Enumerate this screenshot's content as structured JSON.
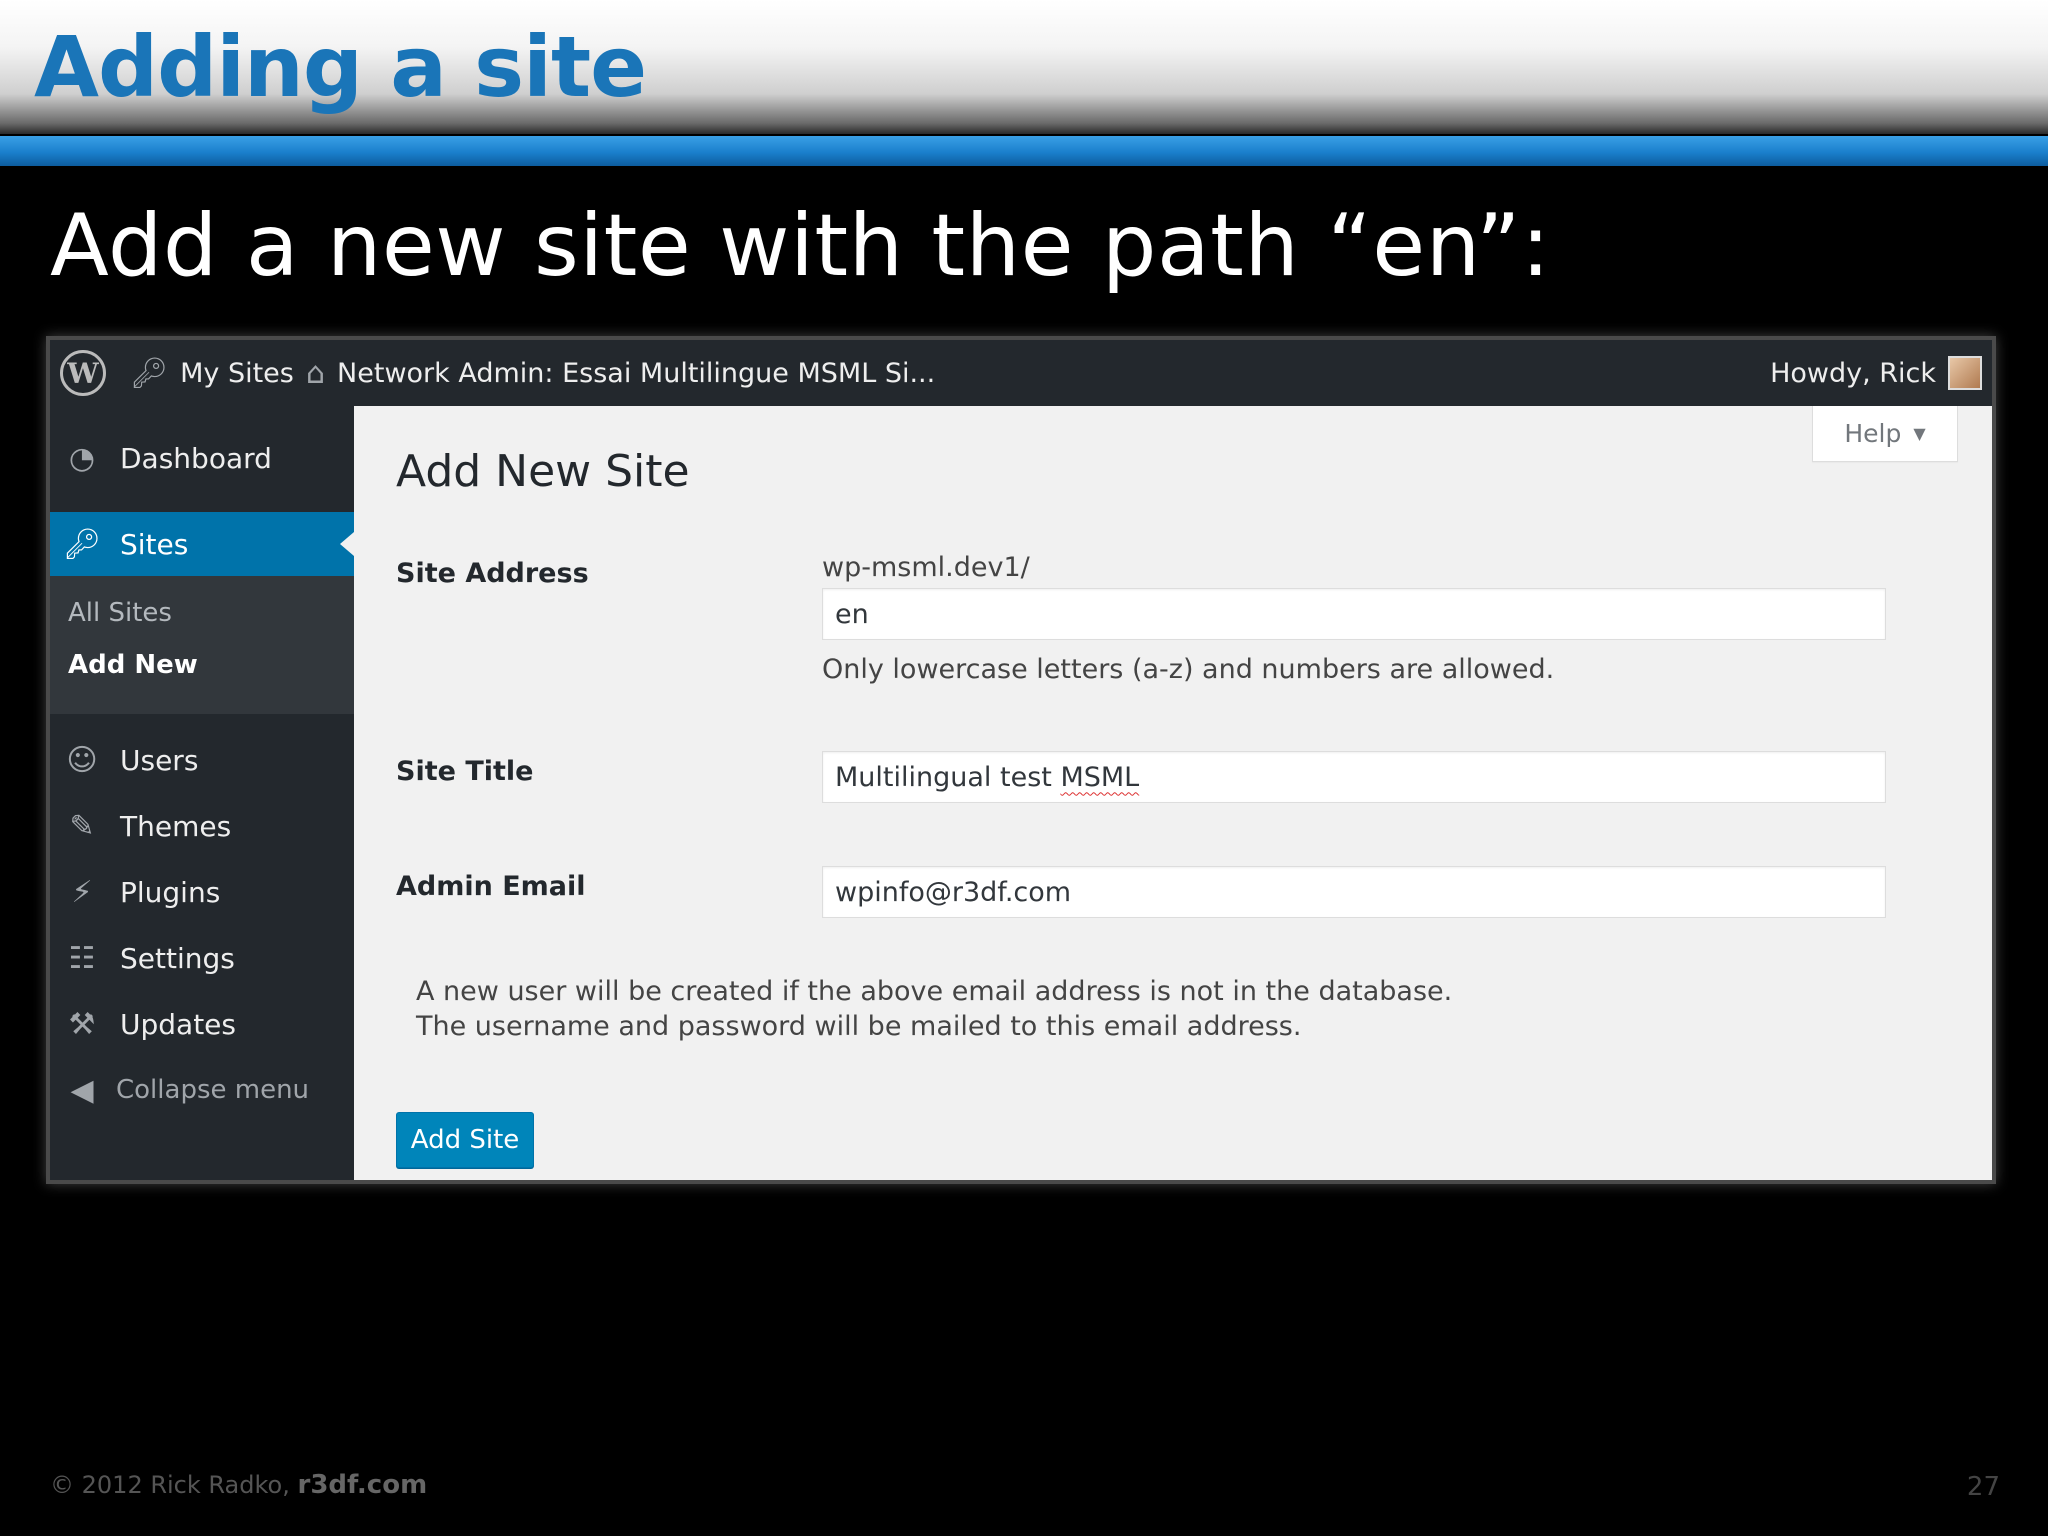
{
  "slide": {
    "title": "Adding a site",
    "subtitle": "Add a new site with the path “en”:",
    "footer_copyright": "© 2012  Rick Radko,",
    "footer_site": "r3df.com",
    "page_number": "27"
  },
  "adminbar": {
    "logo_icon": "wordpress-logo-icon",
    "my_sites": "My Sites",
    "network_admin": "Network Admin: Essai Multilingue MSML Si...",
    "greeting": "Howdy, Rick"
  },
  "sidebar": {
    "items": [
      {
        "label": "Dashboard",
        "icon": "dashboard-icon"
      },
      {
        "label": "Sites",
        "icon": "key-icon"
      },
      {
        "label": "Users",
        "icon": "users-icon"
      },
      {
        "label": "Themes",
        "icon": "themes-icon"
      },
      {
        "label": "Plugins",
        "icon": "plugins-icon"
      },
      {
        "label": "Settings",
        "icon": "settings-icon"
      },
      {
        "label": "Updates",
        "icon": "wrench-icon"
      }
    ],
    "submenu": [
      "All Sites",
      "Add New"
    ],
    "collapse": "Collapse menu"
  },
  "main": {
    "help": "Help",
    "title": "Add New Site",
    "site_address_label": "Site Address",
    "domain_prefix": "wp-msml.dev1/",
    "site_address_value": "en",
    "site_address_hint": "Only lowercase letters (a-z) and numbers are allowed.",
    "site_title_label": "Site Title",
    "site_title_value_prefix": "Multilingual test ",
    "site_title_value_marked": "MSML",
    "admin_email_label": "Admin Email",
    "admin_email_value": "wpinfo@r3df.com",
    "note_line1": "A new user will be created if the above email address is not in the database.",
    "note_line2": "The username and password will be mailed to this email address.",
    "submit": "Add Site"
  },
  "colors": {
    "slide_title": "#1a75b8",
    "blue_band": "#1a7fcc",
    "adminbar_bg": "#23282d",
    "active_menu": "#0073aa",
    "primary_button": "#0085ba"
  }
}
